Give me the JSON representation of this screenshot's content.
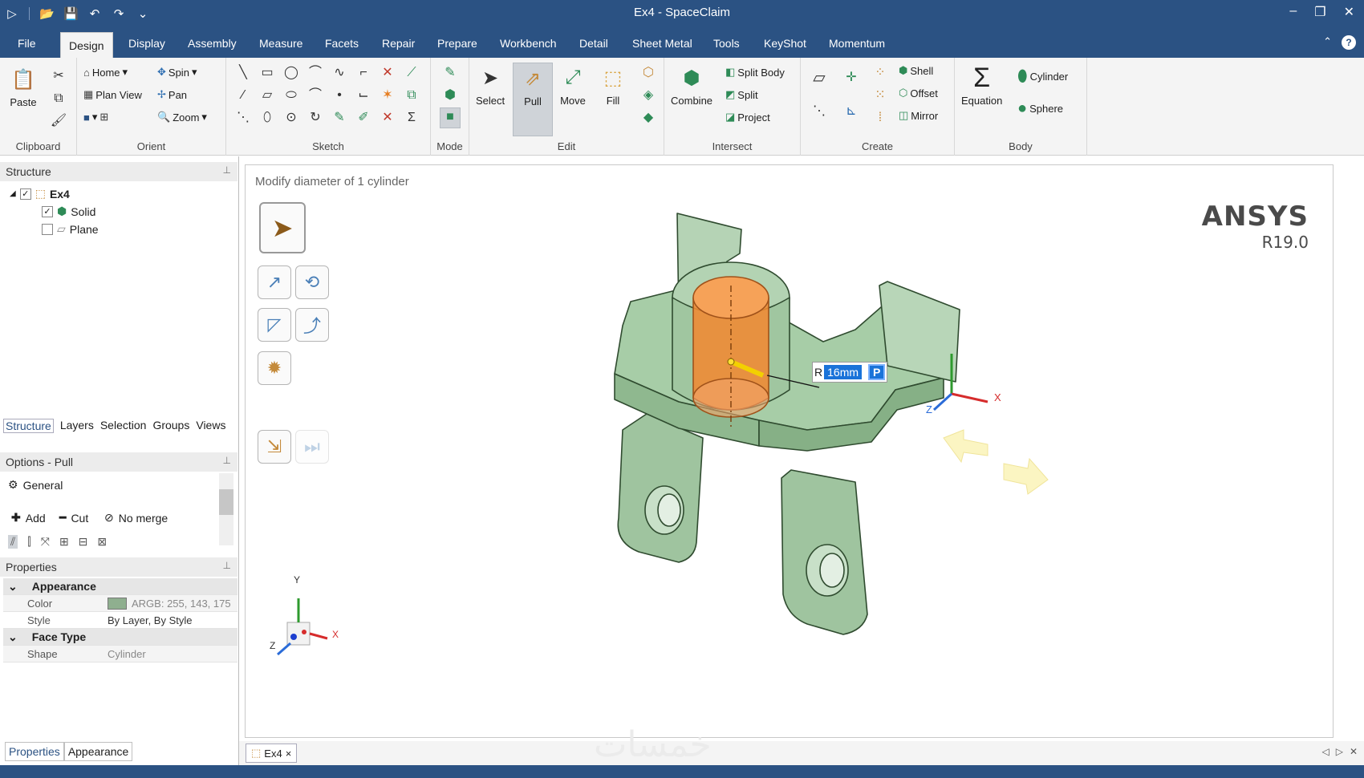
{
  "window": {
    "title": "Ex4 - SpaceClaim"
  },
  "menu": {
    "tabs": [
      "File",
      "Design",
      "Display",
      "Assembly",
      "Measure",
      "Facets",
      "Repair",
      "Prepare",
      "Workbench",
      "Detail",
      "Sheet Metal",
      "Tools",
      "KeyShot",
      "Momentum"
    ],
    "active": "Design"
  },
  "ribbon": {
    "clipboard": {
      "label": "Clipboard",
      "paste": "Paste"
    },
    "orient": {
      "label": "Orient",
      "home": "Home",
      "spin": "Spin",
      "plan_view": "Plan View",
      "pan": "Pan",
      "zoom": "Zoom"
    },
    "sketch": {
      "label": "Sketch"
    },
    "mode": {
      "label": "Mode"
    },
    "edit": {
      "label": "Edit",
      "select": "Select",
      "pull": "Pull",
      "move": "Move",
      "fill": "Fill"
    },
    "intersect": {
      "label": "Intersect",
      "combine": "Combine",
      "split_body": "Split Body",
      "split": "Split",
      "project": "Project"
    },
    "create": {
      "label": "Create",
      "shell": "Shell",
      "offset": "Offset",
      "mirror": "Mirror"
    },
    "body": {
      "label": "Body",
      "equation": "Equation",
      "cylinder": "Cylinder",
      "sphere": "Sphere"
    }
  },
  "structure": {
    "title": "Structure",
    "root": "Ex4",
    "items": [
      {
        "label": "Solid",
        "checked": true
      },
      {
        "label": "Plane",
        "checked": false
      }
    ],
    "tabs": [
      "Structure",
      "Layers",
      "Selection",
      "Groups",
      "Views"
    ]
  },
  "options": {
    "title": "Options - Pull",
    "general": "General",
    "add": "Add",
    "cut": "Cut",
    "no_merge": "No merge"
  },
  "properties": {
    "title": "Properties",
    "appearance": "Appearance",
    "color_key": "Color",
    "color_value": "ARGB: 255, 143, 175",
    "color_swatch": "#8faf8f",
    "style_key": "Style",
    "style_value": "By Layer, By Style",
    "face_type": "Face Type",
    "shape_key": "Shape",
    "shape_value": "Cylinder",
    "bottom_tabs": [
      "Properties",
      "Appearance"
    ]
  },
  "viewport": {
    "hint": "Modify diameter of 1 cylinder",
    "brand": "ANSYS",
    "version": "R19.0",
    "dim_prefix": "R",
    "dim_value": "16mm",
    "dim_button": "P",
    "axis_x": "X",
    "axis_y": "Y",
    "axis_z": "Z"
  },
  "doc": {
    "tab": "Ex4",
    "close": "×"
  },
  "watermark": "خمسات",
  "colors": {
    "titlebar": "#2b5283",
    "model": "#9cc49c",
    "cylinder": "#f08a32",
    "accent": "#1a73d9"
  }
}
